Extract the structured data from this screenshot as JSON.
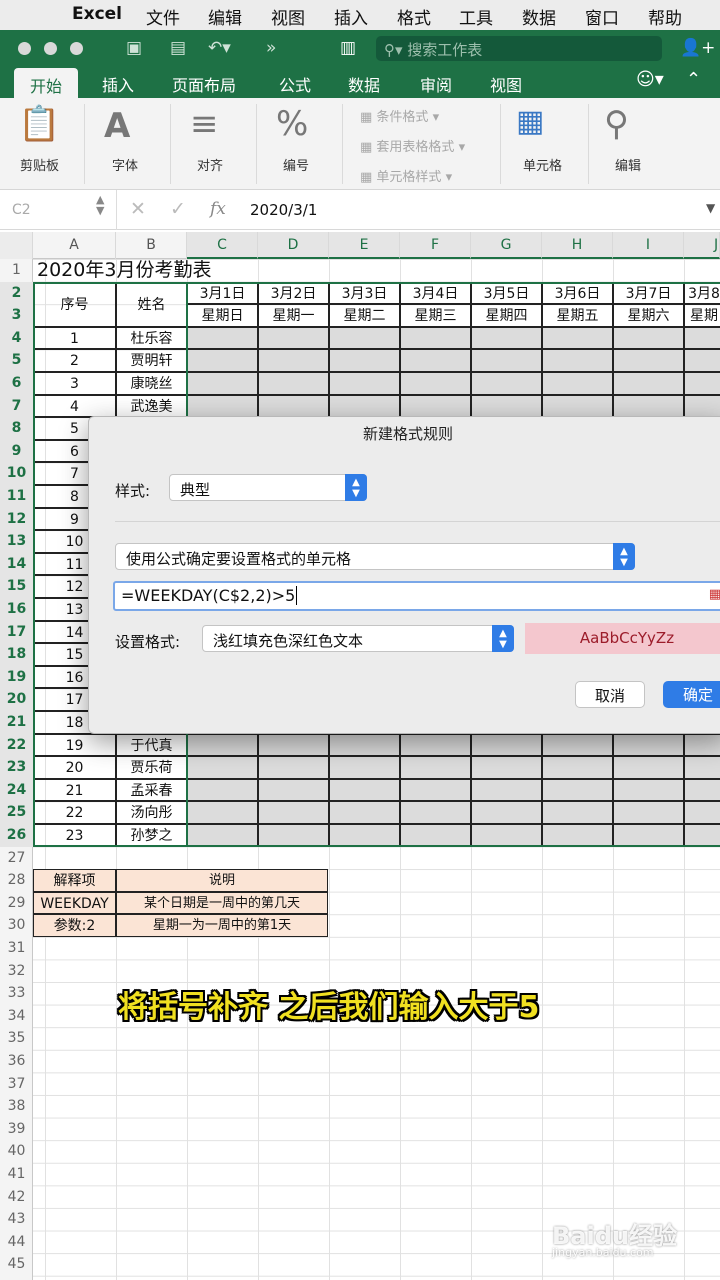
{
  "menubar": {
    "app": "Excel",
    "items": [
      "文件",
      "编辑",
      "视图",
      "插入",
      "格式",
      "工具",
      "数据",
      "窗口",
      "帮助"
    ]
  },
  "titlebar": {
    "search_placeholder": "搜索工作表"
  },
  "tabs": [
    "开始",
    "插入",
    "页面布局",
    "公式",
    "数据",
    "审阅",
    "视图"
  ],
  "ribbon": {
    "clipboard": "剪贴板",
    "font": "字体",
    "align": "对齐",
    "number": "编号",
    "cond_format": "条件格式",
    "table_format": "套用表格格式",
    "cell_style": "单元格样式",
    "cells": "单元格",
    "edit": "编辑"
  },
  "formula_bar": {
    "cell_ref": "C2",
    "fx": "fx",
    "value": "2020/3/1"
  },
  "columns": [
    "A",
    "B",
    "C",
    "D",
    "E",
    "F",
    "G",
    "H",
    "I",
    "J"
  ],
  "selected_columns": [
    "C",
    "D",
    "E",
    "F",
    "G",
    "H",
    "I",
    "J"
  ],
  "rows": [
    "1",
    "2",
    "3",
    "4",
    "5",
    "6",
    "7",
    "8",
    "9",
    "10",
    "11",
    "12",
    "13",
    "14",
    "15",
    "16",
    "17",
    "18",
    "19",
    "20",
    "21",
    "22",
    "23",
    "24",
    "25",
    "26",
    "27",
    "28",
    "29",
    "30",
    "31",
    "32",
    "33",
    "34",
    "35",
    "36",
    "37",
    "38",
    "39",
    "40",
    "41",
    "42",
    "43",
    "44",
    "45"
  ],
  "sheet": {
    "title": "2020年3月份考勤表",
    "hdr_no": "序号",
    "hdr_name": "姓名",
    "dates": [
      "3月1日",
      "3月2日",
      "3月3日",
      "3月4日",
      "3月5日",
      "3月6日",
      "3月7日",
      "3月8"
    ],
    "weekdays": [
      "星期日",
      "星期一",
      "星期二",
      "星期三",
      "星期四",
      "星期五",
      "星期六",
      "星期"
    ],
    "top_rows": [
      {
        "no": "1",
        "name": "杜乐容"
      },
      {
        "no": "2",
        "name": "贾明轩"
      },
      {
        "no": "3",
        "name": "康晓丝"
      },
      {
        "no": "4",
        "name": "武逸美"
      }
    ],
    "mid_nos": [
      "5",
      "6",
      "7",
      "8",
      "9",
      "10",
      "11",
      "12",
      "13",
      "14",
      "15",
      "16",
      "17",
      "18"
    ],
    "bottom_rows": [
      {
        "no": "19",
        "name": "于代真"
      },
      {
        "no": "20",
        "name": "贾乐荷"
      },
      {
        "no": "21",
        "name": "孟采春"
      },
      {
        "no": "22",
        "name": "汤向彤"
      },
      {
        "no": "23",
        "name": "孙梦之"
      }
    ],
    "notes": {
      "h1": "解释项",
      "h2": "说明",
      "r1a": "WEEKDAY",
      "r1b": "某个日期是一周中的第几天",
      "r2a": "参数:2",
      "r2b": "星期一为一周中的第1天"
    }
  },
  "dialog": {
    "title": "新建格式规则",
    "style_label": "样式:",
    "style_value": "典型",
    "rule_type": "使用公式确定要设置格式的单元格",
    "formula": "=WEEKDAY(C$2,2)>5",
    "format_label": "设置格式:",
    "format_value": "浅红填充色深红色文本",
    "preview": "AaBbCcYyZz",
    "cancel": "取消",
    "ok": "确定"
  },
  "caption": "将括号补齐  之后我们输入大于5",
  "watermark": "Baidu经验",
  "watermark_url": "jingyan.baidu.com",
  "colors": {
    "excel_green": "#1e7145",
    "preview_bg": "#f4c7ce",
    "preview_text": "#9c1c2a",
    "notes_fill": "#fbe4d5",
    "caption": "#f0e020"
  }
}
